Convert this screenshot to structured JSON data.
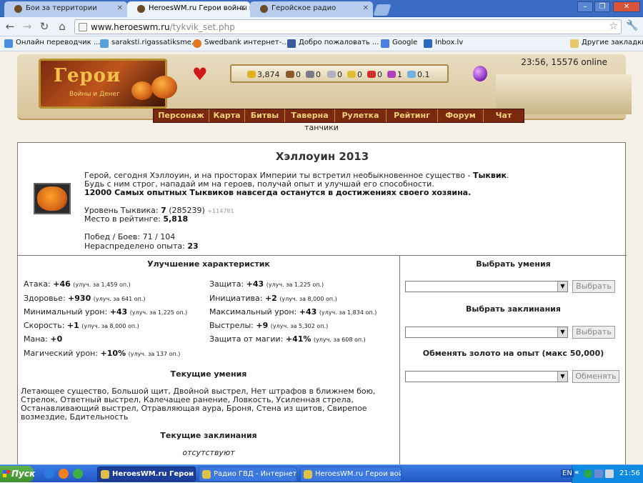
{
  "browser": {
    "tabs": [
      {
        "title": "Бои за территории",
        "active": false
      },
      {
        "title": "HeroesWM.ru Герои войны и",
        "active": true
      },
      {
        "title": "Геройское радио",
        "active": false
      }
    ],
    "window_controls": [
      "minimize",
      "restore",
      "close"
    ],
    "address": {
      "host": "www.heroeswm.ru",
      "path": "/tykvik_set.php"
    },
    "bookmarks": [
      {
        "label": "Онлайн переводчик ...",
        "icon": "translate-icon"
      },
      {
        "label": "saraksti.rigassatiksme...",
        "icon": "bus-icon"
      },
      {
        "label": "Swedbank интернет-...",
        "icon": "bank-icon"
      },
      {
        "label": "Добро пожаловать ...",
        "icon": "facebook-icon"
      },
      {
        "label": "Google",
        "icon": "google-icon"
      },
      {
        "label": "Inbox.lv",
        "icon": "mail-icon"
      }
    ],
    "other_bookmarks": "Другие закладки"
  },
  "game_header": {
    "logo_title": "Герои",
    "logo_subtitle": "Войны и Денег",
    "time_online": "23:56, 15576 online",
    "resources": [
      {
        "name": "gold",
        "value": "3,874",
        "color": "#e0b020"
      },
      {
        "name": "wood",
        "value": "0",
        "color": "#8a5a2a"
      },
      {
        "name": "ore",
        "value": "0",
        "color": "#7a7a8a"
      },
      {
        "name": "mercury",
        "value": "0",
        "color": "#b0b0c0"
      },
      {
        "name": "sulfur",
        "value": "0",
        "color": "#e0c030"
      },
      {
        "name": "crystals",
        "value": "0",
        "color": "#d03030"
      },
      {
        "name": "gems",
        "value": "1",
        "color": "#b040c0"
      },
      {
        "name": "diamonds",
        "value": "0.1",
        "color": "#70b0e0"
      }
    ],
    "menu": [
      "Персонаж",
      "Карта",
      "Битвы",
      "Таверна",
      "Рулетка",
      "Рейтинг",
      "Форум",
      "Чат"
    ],
    "sublink": "танчики"
  },
  "event": {
    "title": "Хэллоуин 2013",
    "intro_line1": "Герой, сегодня Хэллоуин, и на просторах Империи ты встретил необыкновенное существо - ",
    "intro_creature": "Тыквик",
    "intro_line1_end": ".",
    "intro_line2": "Будь с ним строг, нападай им на героев, получай опыт и улучшай его способности.",
    "intro_line3": "12000 Самых опытных Тыквиков навсегда останутся в достижениях своего хозяина.",
    "level_label": "Уровень Тыквика:",
    "level_value": "7",
    "level_exp": "(285239)",
    "level_next": "+114781",
    "rank_label": "Место в рейтинге:",
    "rank_value": "5,818",
    "wins_label": "Побед / Боев: 71 / 104",
    "unspent_label": "Нераспределено опыта:",
    "unspent_value": "23"
  },
  "improvements": {
    "heading": "Улучшение характеристик",
    "left": [
      {
        "label": "Атака:",
        "value": "+46",
        "cost": "(улуч. за 1,459 оп.)"
      },
      {
        "label": "Здоровье:",
        "value": "+930",
        "cost": "(улуч. за 641 оп.)"
      },
      {
        "label": "Минимальный урон:",
        "value": "+43",
        "cost": "(улуч. за 1,225 оп.)"
      },
      {
        "label": "Скорость:",
        "value": "+1",
        "cost": "(улуч. за 8,000 оп.)"
      },
      {
        "label": "Мана:",
        "value": "+0",
        "cost": ""
      },
      {
        "label": "Магический урон:",
        "value": "+10%",
        "cost": "(улуч. за 137 оп.)"
      }
    ],
    "right": [
      {
        "label": "Защита:",
        "value": "+43",
        "cost": "(улуч. за 1,225 оп.)"
      },
      {
        "label": "Инициатива:",
        "value": "+2",
        "cost": "(улуч. за 8,000 оп.)"
      },
      {
        "label": "Максимальный урон:",
        "value": "+43",
        "cost": "(улуч. за 1,834 оп.)"
      },
      {
        "label": "Выстрелы:",
        "value": "+9",
        "cost": "(улуч. за 5,302 оп.)"
      },
      {
        "label": "Защита от магии:",
        "value": "+41%",
        "cost": "(улуч. за 608 оп.)"
      }
    ]
  },
  "abilities": {
    "heading": "Текущие умения",
    "text": "Летающее существо, Большой щит, Двойной выстрел, Нет штрафов в ближнем бою, Стрелок, Ответный выстрел, Калечащее ранение, Ловкость, Усиленная стрела, Останавливающий выстрел, Отравляющая аура, Броня, Стена из щитов, Свирепое возмездие, Бдительность"
  },
  "spells": {
    "heading": "Текущие заклинания",
    "text": "отсутствуют"
  },
  "right_panel": {
    "choose_skill": "Выбрать умения",
    "choose_skill_button": "Выбрать",
    "choose_spell": "Выбрать заклинания",
    "choose_spell_button": "Выбрать",
    "exchange": "Обменять золото на опыт (макс 50,000)",
    "exchange_button": "Обменять"
  },
  "taskbar": {
    "start": "Пуск",
    "items": [
      {
        "label": "HeroesWM.ru Герои в...",
        "active": true
      },
      {
        "label": "Радио ГВД - Интернет",
        "active": false
      },
      {
        "label": "HeroesWM.ru Герои вой...",
        "active": false
      }
    ],
    "lang": "EN",
    "clock": "21:56"
  }
}
